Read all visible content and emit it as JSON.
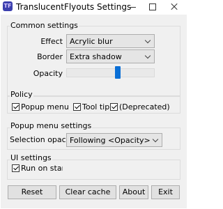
{
  "window": {
    "title": "TranslucentFlyouts Settings",
    "app_icon_text": "TF"
  },
  "common": {
    "title": "Common settings",
    "effect_label": "Effect",
    "effect_value": "Acrylic blur",
    "border_label": "Border",
    "border_value": "Extra shadow",
    "opacity_label": "Opacity",
    "opacity_position": 0.59
  },
  "policy": {
    "title": "Policy",
    "popup_menu": {
      "label": "Popup menu",
      "checked": true
    },
    "tool_tip": {
      "label": "Tool tip",
      "checked": true
    },
    "deprecated": {
      "label": "(Deprecated)",
      "checked": true
    }
  },
  "popup": {
    "title": "Popup menu settings",
    "selection_opacity_label": "Selection opacity",
    "selection_opacity_value": "Following <Opacity>"
  },
  "ui": {
    "title": "UI settings",
    "run_on_startup": {
      "label": "Run on startup",
      "checked": true
    }
  },
  "buttons": {
    "reset": "Reset",
    "clear_cache": "Clear cache",
    "about": "About",
    "exit": "Exit"
  }
}
